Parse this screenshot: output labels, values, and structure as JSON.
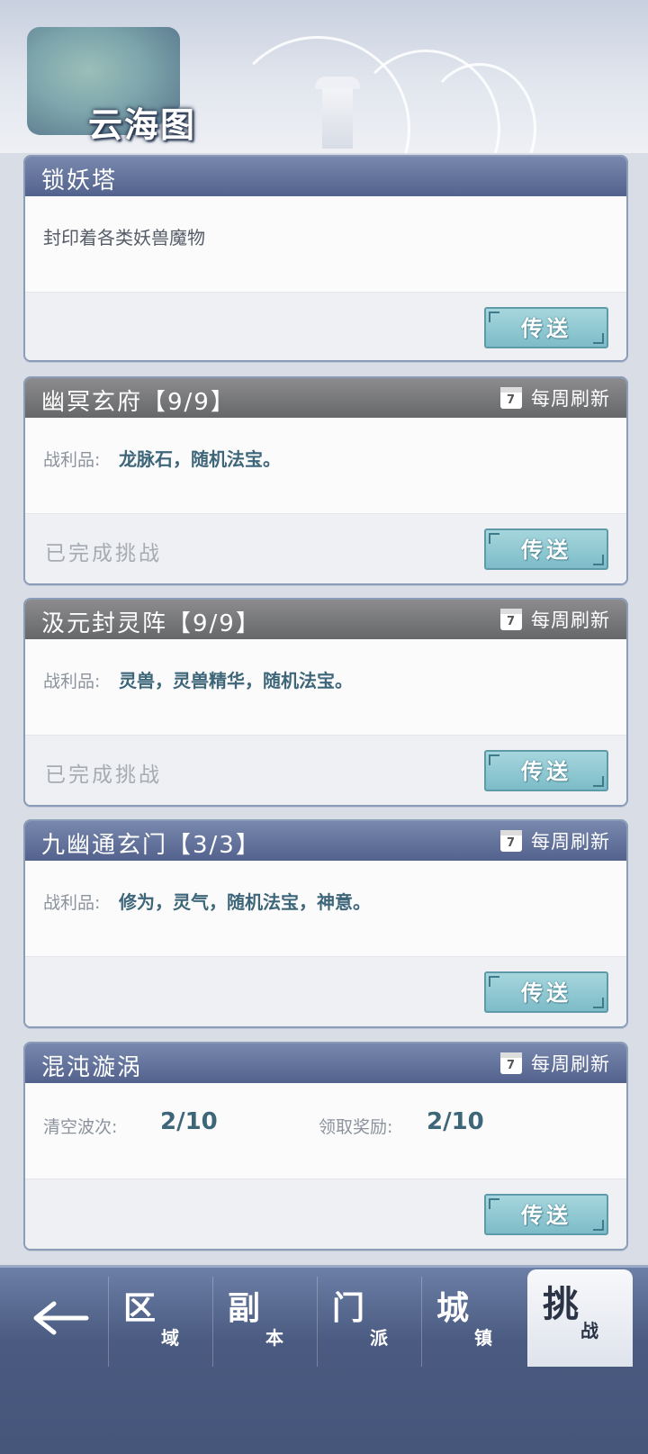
{
  "header": {
    "title": "云海图"
  },
  "cards": [
    {
      "title": "锁妖塔",
      "description": "封印着各类妖兽魔物",
      "button": "传送"
    },
    {
      "title": "幽冥玄府【9/9】",
      "refresh": "每周刷新",
      "calendar_day": "7",
      "loot_label": "战利品:",
      "loot": "龙脉石，随机法宝。",
      "status": "已完成挑战",
      "button": "传送"
    },
    {
      "title": "汲元封灵阵【9/9】",
      "refresh": "每周刷新",
      "calendar_day": "7",
      "loot_label": "战利品:",
      "loot": "灵兽，灵兽精华，随机法宝。",
      "status": "已完成挑战",
      "button": "传送"
    },
    {
      "title": "九幽通玄门【3/3】",
      "refresh": "每周刷新",
      "calendar_day": "7",
      "loot_label": "战利品:",
      "loot": "修为，灵气，随机法宝，神意。",
      "button": "传送"
    },
    {
      "title": "混沌漩涡",
      "refresh": "每周刷新",
      "calendar_day": "7",
      "waves_label": "清空波次:",
      "waves_value": "2/10",
      "reward_label": "领取奖励:",
      "reward_value": "2/10",
      "button": "传送"
    }
  ],
  "nav": {
    "tabs": [
      {
        "big": "区",
        "small": "域"
      },
      {
        "big": "副",
        "small": "本"
      },
      {
        "big": "门",
        "small": "派"
      },
      {
        "big": "城",
        "small": "镇"
      },
      {
        "big": "挑",
        "small": "战"
      }
    ],
    "active_index": 4
  },
  "colors": {
    "accent_header": "#52628d",
    "completed_header": "#666769",
    "button": "#7dbcc8"
  }
}
